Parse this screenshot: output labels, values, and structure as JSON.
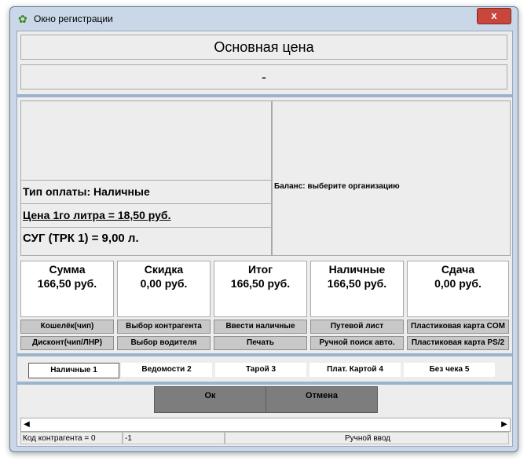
{
  "window": {
    "title": "Окно регистрации",
    "close_label": "x"
  },
  "header": {
    "price_title": "Основная цена",
    "dash": "-"
  },
  "info": {
    "payment_type": "Тип оплаты:  Наличные",
    "price_per_liter": "Цена 1го литра = 18,50  руб.",
    "fuel": "СУГ (ТРК 1) = 9,00 л.",
    "balance": "Баланс: выберите организацию"
  },
  "sums": [
    {
      "title": "Сумма",
      "value": "166,50  руб."
    },
    {
      "title": "Скидка",
      "value": "0,00  руб."
    },
    {
      "title": "Итог",
      "value": "166,50  руб."
    },
    {
      "title": "Наличные",
      "value": "166,50  руб."
    },
    {
      "title": "Сдача",
      "value": "0,00  руб."
    }
  ],
  "buttons_row1": [
    "Кошелёк(чип)",
    "Выбор контрагента",
    "Ввести наличные",
    "Путевой лист",
    "Пластиковая карта COM"
  ],
  "buttons_row2": [
    "Дисконт(чип/ЛНР)",
    "Выбор водителя",
    "Печать",
    "Ручной поиск авто.",
    "Пластиковая карта PS/2"
  ],
  "tabs": [
    "Наличные 1",
    "Ведомости 2",
    "Тарой 3",
    "Плат. Картой 4",
    "Без чека 5"
  ],
  "actions": {
    "ok": "Ок",
    "cancel": "Отмена"
  },
  "status": {
    "contractor": "Код контрагента = 0",
    "value": "-1",
    "mode": "Ручной ввод"
  }
}
